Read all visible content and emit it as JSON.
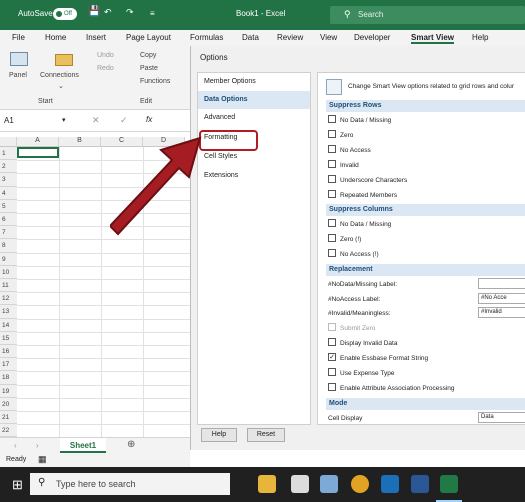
{
  "title": {
    "autosave": "AutoSave",
    "autosave_state": "Off",
    "doc": "Book1 - Excel",
    "search": "Search"
  },
  "menu": [
    "File",
    "Home",
    "Insert",
    "Page Layout",
    "Formulas",
    "Data",
    "Review",
    "View",
    "Developer",
    "Smart View",
    "Help"
  ],
  "ribbon": {
    "panel": "Panel",
    "connections": "Connections",
    "undo": "Undo",
    "redo": "Redo",
    "copy": "Copy",
    "paste": "Paste",
    "functions": "Functions",
    "group_start": "Start",
    "group_edit": "Edit"
  },
  "formula_bar": {
    "cell_ref": "A1",
    "fx": "fx"
  },
  "columns": [
    "A",
    "B",
    "C",
    "D"
  ],
  "rows": [
    "1",
    "2",
    "3",
    "4",
    "5",
    "6",
    "7",
    "8",
    "9",
    "10",
    "11",
    "12",
    "13",
    "14",
    "15",
    "16",
    "17",
    "18",
    "19",
    "20",
    "21",
    "22"
  ],
  "sheet_tab": "Sheet1",
  "status": "Ready",
  "taskbar": {
    "search": "Type here to search"
  },
  "dialog": {
    "title": "Options",
    "nav": [
      "Member Options",
      "Data Options",
      "Advanced",
      "Formatting",
      "Cell Styles",
      "Extensions"
    ],
    "selected_nav": "Data Options",
    "description": "Change Smart View options related to grid rows and colur",
    "sections": {
      "suppress_rows": "Suppress Rows",
      "suppress_columns": "Suppress Columns",
      "replacement": "Replacement",
      "mode": "Mode"
    },
    "rows_opts": [
      "No Data / Missing",
      "Zero",
      "No Access",
      "Invalid",
      "Underscore Characters",
      "Repeated Members"
    ],
    "cols_opts": [
      "No Data / Missing",
      "Zero (!)",
      "No Access (!)"
    ],
    "replacement": {
      "nodata_label": "#NoData/Missing Label:",
      "noaccess_label": "#NoAccess Label:",
      "invalid_label": "#Invalid/Meaningless:",
      "nodata_value": "",
      "noaccess_value": "#No Acce",
      "invalid_value": "#Invalid",
      "submit_zero": "Submit Zero",
      "display_invalid": "Display Invalid Data",
      "essbase_format": "Enable Essbase Format String",
      "expense_type": "Use Expense Type",
      "attr_assoc": "Enable Attribute Association Processing"
    },
    "mode": {
      "cell_display_label": "Cell Display",
      "cell_display_value": "Data"
    },
    "buttons": {
      "help": "Help",
      "reset": "Reset"
    }
  }
}
